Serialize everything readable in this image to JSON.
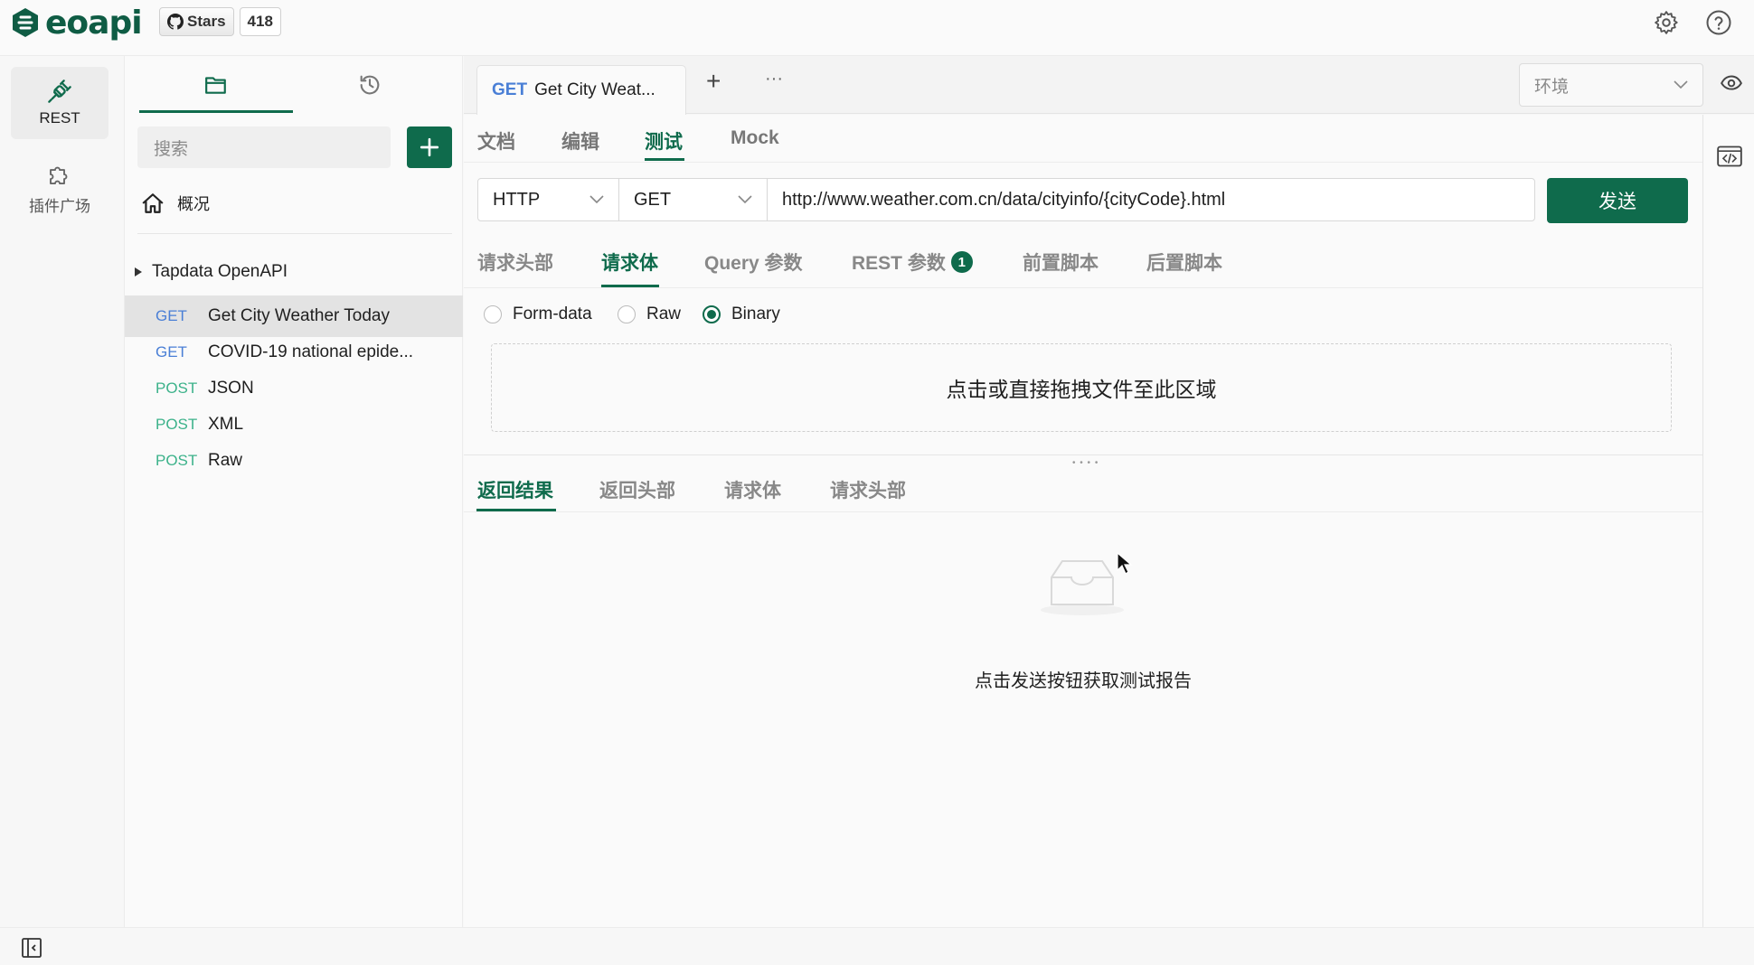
{
  "app": {
    "brand": "eoapi",
    "github": {
      "stars_label": "Stars",
      "stars_count": "418"
    }
  },
  "rail": {
    "items": [
      {
        "label": "REST",
        "icon": "plug-icon"
      },
      {
        "label": "插件广场",
        "icon": "puzzle-icon"
      }
    ]
  },
  "sidebar": {
    "tabs": [
      "folder-icon",
      "history-icon"
    ],
    "search_placeholder": "搜索",
    "overview_label": "概况",
    "group_name": "Tapdata OpenAPI",
    "apis": [
      {
        "method": "GET",
        "name": "Get City Weather Today",
        "selected": true
      },
      {
        "method": "GET",
        "name": "COVID-19 national epide...",
        "selected": false
      },
      {
        "method": "POST",
        "name": "JSON",
        "selected": false
      },
      {
        "method": "POST",
        "name": "XML",
        "selected": false
      },
      {
        "method": "POST",
        "name": "Raw",
        "selected": false
      }
    ]
  },
  "tabstrip": {
    "open_tab": {
      "method": "GET",
      "title": "Get City Weat..."
    },
    "add": "+",
    "more": "···",
    "env_placeholder": "环境"
  },
  "main": {
    "sub_tabs": [
      "文档",
      "编辑",
      "测试",
      "Mock"
    ],
    "active_sub_tab": "测试",
    "protocol": "HTTP",
    "method": "GET",
    "url": "http://www.weather.com.cn/data/cityinfo/{cityCode}.html",
    "send_label": "发送",
    "body_tabs": [
      {
        "label": "请求头部"
      },
      {
        "label": "请求体"
      },
      {
        "label": "Query 参数"
      },
      {
        "label": "REST 参数",
        "badge": "1"
      },
      {
        "label": "前置脚本"
      },
      {
        "label": "后置脚本"
      }
    ],
    "active_body_tab": "请求体",
    "body_types": [
      "Form-data",
      "Raw",
      "Binary"
    ],
    "selected_body_type": "Binary",
    "dropzone_text": "点击或直接拖拽文件至此区域",
    "response_tabs": [
      "返回结果",
      "返回头部",
      "请求体",
      "请求头部"
    ],
    "active_response_tab": "返回结果",
    "empty_text": "点击发送按钮获取测试报告"
  },
  "colors": {
    "accent": "#0f6b4c",
    "get": "#4a7fd6",
    "post": "#3cb28a"
  }
}
